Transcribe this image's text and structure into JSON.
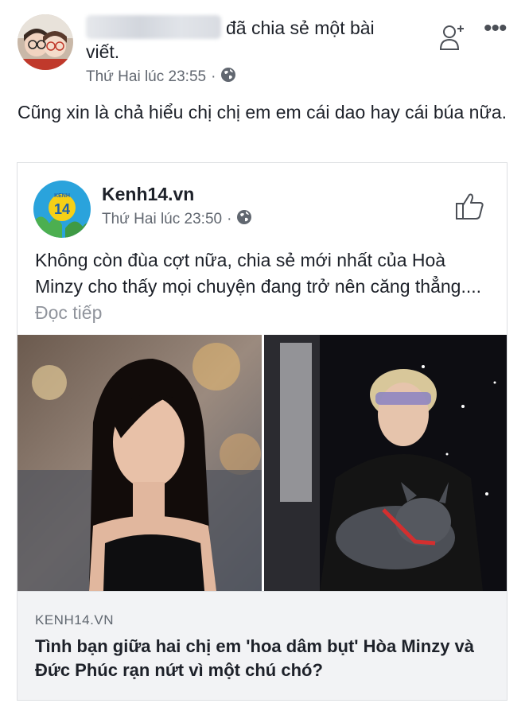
{
  "post": {
    "author_suffix": "đã chia sẻ một bài viết.",
    "time": "Thứ Hai lúc 23:55",
    "separator": "·",
    "status_text": "Cũng xin là chả hiểu chị chị em em cái dao hay cái búa nữa.",
    "icons": {
      "audience": "globe-icon",
      "add_friend": "add-friend-icon",
      "more": "more-options-icon"
    },
    "more_glyph": "•••"
  },
  "shared": {
    "page_name": "Kenh14.vn",
    "logo_text": "14",
    "logo_top": "KENH",
    "time": "Thứ Hai lúc 23:50",
    "separator": "·",
    "text": "Không còn đùa cợt nữa, chia sẻ mới nhất của Hoà Minzy cho thấy mọi chuyện đang trở nên căng thẳng....",
    "read_more": "Đọc tiếp",
    "icons": {
      "like": "thumbs-up-icon",
      "audience": "globe-icon"
    },
    "link": {
      "domain": "KENH14.VN",
      "title": "Tình bạn giữa hai chị em 'hoa dâm bụt' Hòa Minzy và Đức Phúc rạn nứt vì một chú chó?"
    }
  },
  "colors": {
    "text": "#1d2129",
    "meta": "#616770",
    "link_bg": "#f2f3f5",
    "logo_blue": "#2aa3dc",
    "logo_yellow": "#f5d016"
  }
}
